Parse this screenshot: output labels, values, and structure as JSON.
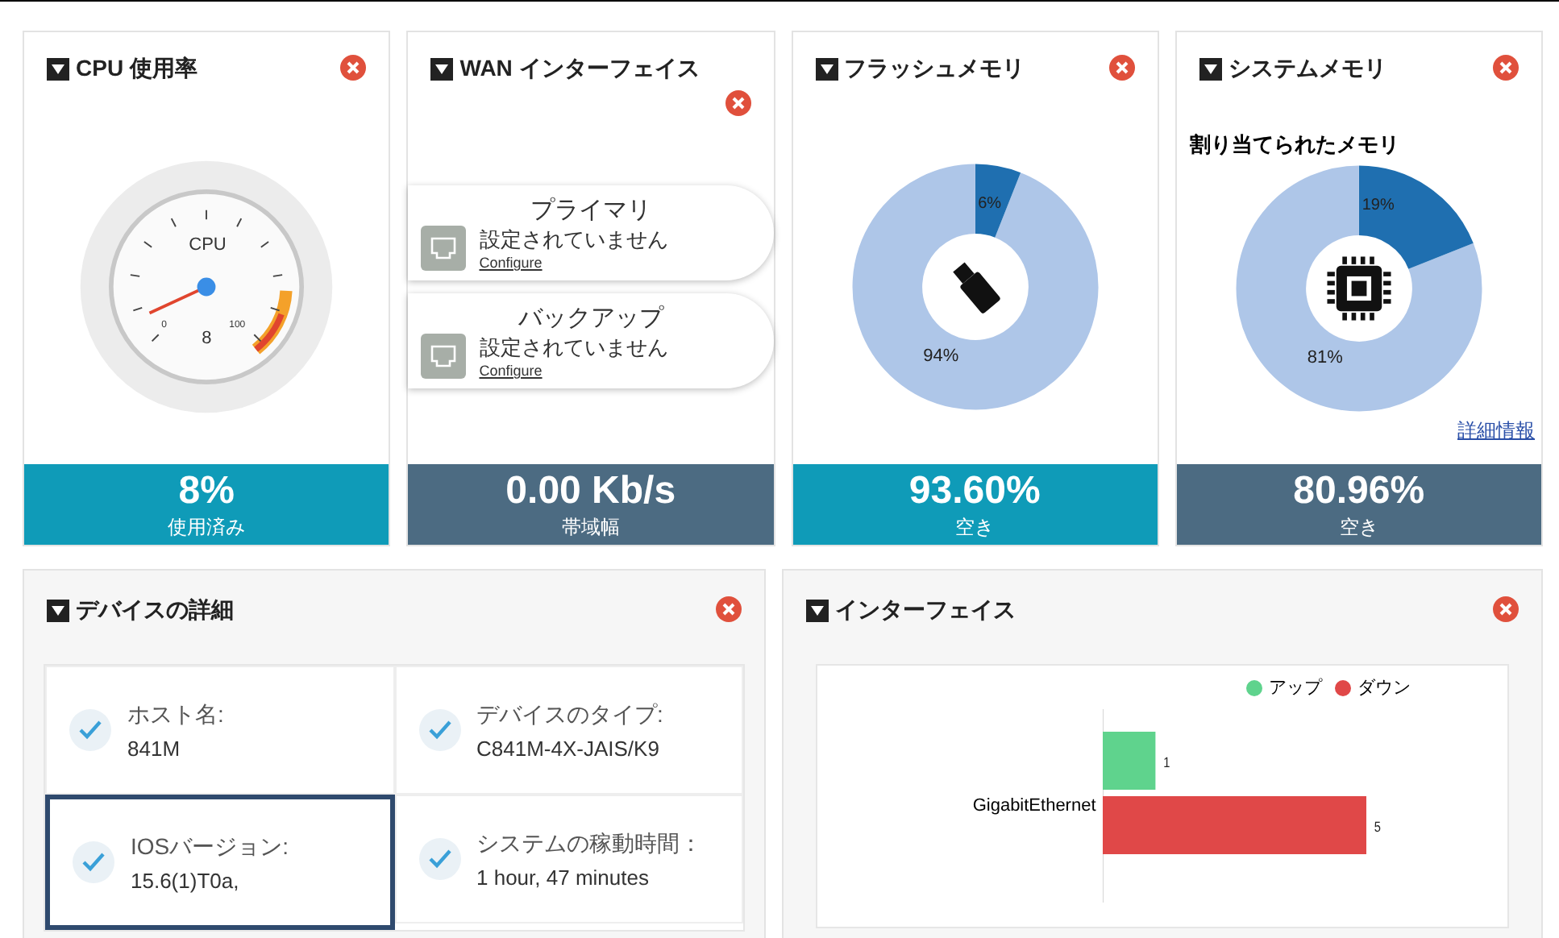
{
  "widgets": [
    {
      "kind": "gauge",
      "title": "CPU 使用率",
      "gauge_label": "CPU",
      "tick_min": "0",
      "gauge_reading": "8",
      "tick_max": "100",
      "value": "8%",
      "caption": "使用済み"
    },
    {
      "kind": "wan",
      "title": "WAN インターフェイス",
      "links": [
        {
          "name": "プライマリ",
          "status": "設定されていません",
          "action": "Configure"
        },
        {
          "name": "バックアップ",
          "status": "設定されていません",
          "action": "Configure"
        }
      ],
      "value": "0.00 Kb/s",
      "caption": "帯域幅"
    },
    {
      "kind": "donut",
      "title": "フラッシュメモリ",
      "used_label": "6%",
      "free_label": "94%",
      "value": "93.60%",
      "caption": "空き"
    },
    {
      "kind": "donut",
      "title": "システムメモリ",
      "heading": "割り当てられたメモリ",
      "used_label": "19%",
      "free_label": "81%",
      "link": "詳細情報",
      "value": "80.96%",
      "caption": "空き"
    }
  ],
  "device": {
    "title": "デバイスの詳細",
    "items": [
      {
        "label": "ホスト名:",
        "value": "841M",
        "selected": false
      },
      {
        "label": "デバイスのタイプ:",
        "value": "C841M-4X-JAIS/K9",
        "selected": false
      },
      {
        "label": "IOSバージョン:",
        "value": "15.6(1)T0a,",
        "selected": true
      },
      {
        "label": "システムの稼動時間：",
        "value": "1 hour, 47 minutes",
        "selected": false
      }
    ]
  },
  "interfaces": {
    "title": "インターフェイス",
    "chart_data": {
      "type": "bar",
      "orientation": "horizontal",
      "legend": "upper right",
      "categories": [
        "GigabitEthernet"
      ],
      "series": [
        {
          "name": "アップ",
          "color": "#5fd38d",
          "values": [
            1
          ]
        },
        {
          "name": "ダウン",
          "color": "#e04848",
          "values": [
            5
          ]
        }
      ],
      "data_labels": true
    }
  }
}
